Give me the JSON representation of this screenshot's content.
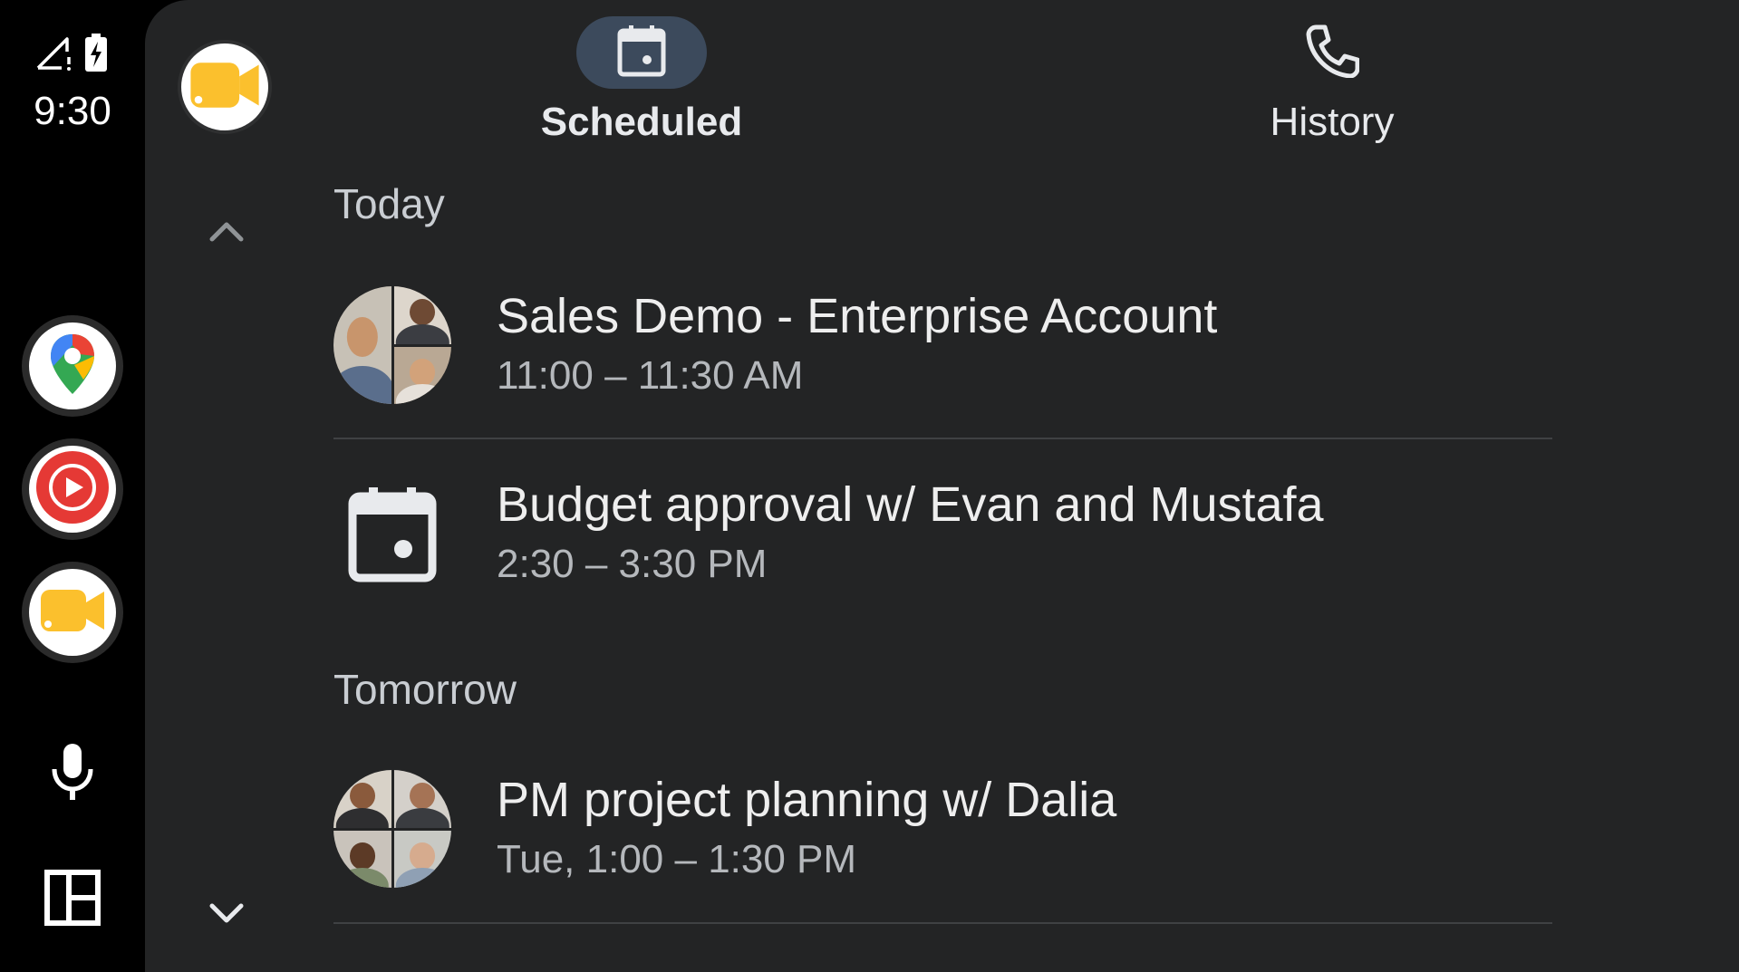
{
  "status": {
    "time": "9:30",
    "icons": [
      "signal-off-icon",
      "battery-charging-icon"
    ]
  },
  "rail": {
    "apps": [
      {
        "name": "maps",
        "icon": "maps-pin-icon"
      },
      {
        "name": "youtube-music",
        "icon": "youtube-music-icon"
      },
      {
        "name": "meet",
        "icon": "meet-camera-icon"
      }
    ],
    "bottom_icons": [
      "microphone-icon",
      "dashboard-layout-icon"
    ]
  },
  "header": {
    "tabs": [
      {
        "label": "Scheduled",
        "icon": "calendar-icon",
        "active": true
      },
      {
        "label": "History",
        "icon": "phone-icon",
        "active": false
      }
    ]
  },
  "sections": [
    {
      "label": "Today",
      "items": [
        {
          "title": "Sales Demo - Enterprise Account",
          "time": "11:00 – 11:30 AM",
          "avatar": "group-avatar"
        },
        {
          "title": "Budget approval w/ Evan and Mustafa",
          "time": "2:30 – 3:30 PM",
          "avatar": "calendar-icon"
        }
      ]
    },
    {
      "label": "Tomorrow",
      "items": [
        {
          "title": "PM project planning w/ Dalia",
          "time": "Tue, 1:00 – 1:30 PM",
          "avatar": "group-avatar"
        }
      ]
    }
  ],
  "colors": {
    "background": "#000000",
    "panel": "#232425",
    "active_tab_pill": "#3c4a5c",
    "meet_yellow": "#fbc02d",
    "youtube_red": "#e53935"
  }
}
